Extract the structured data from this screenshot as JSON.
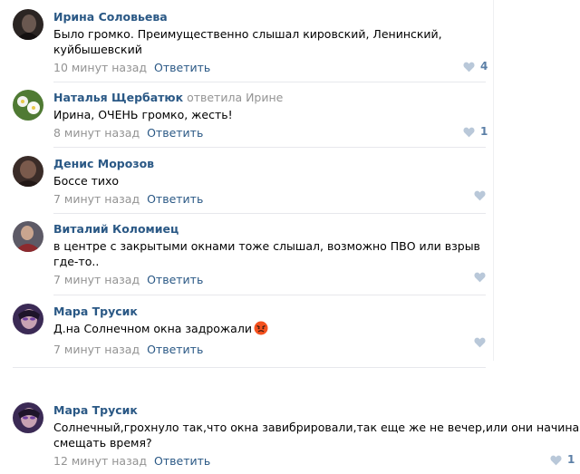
{
  "comments": [
    {
      "author": "Ирина Соловьева",
      "reply_note": "",
      "text_lines": [
        "Было громко. Преимущественно слышал кировский, Ленинский,",
        "куйбышевский"
      ],
      "time": "10 минут назад",
      "reply_label": "Ответить",
      "likes": "4"
    },
    {
      "author": "Наталья Щербатюк",
      "reply_note": "ответила Ирине",
      "text_lines": [
        "Ирина, ОЧЕНЬ громко, жесть!"
      ],
      "time": "8 минут назад",
      "reply_label": "Ответить",
      "likes": "1"
    },
    {
      "author": "Денис Морозов",
      "reply_note": "",
      "text_lines": [
        "Боссе тихо"
      ],
      "time": "7 минут назад",
      "reply_label": "Ответить",
      "likes": ""
    },
    {
      "author": "Виталий Коломиец",
      "reply_note": "",
      "text_lines": [
        "в центре с закрытыми окнами тоже слышал, возможно ПВО или взрыв",
        "где-то.."
      ],
      "time": "7 минут назад",
      "reply_label": "Ответить",
      "likes": ""
    },
    {
      "author": "Мара Трусик",
      "reply_note": "",
      "text_lines": [
        "Д.на Солнечном окна задрожали"
      ],
      "time": "7 минут назад",
      "reply_label": "Ответить",
      "likes": "",
      "emoji": "angry-face-emoji"
    },
    {
      "author": "Мара Трусик",
      "reply_note": "",
      "text_lines": [
        "Солнечный,грохнуло так,что окна завибрировали,так еще же не вечер,или они начинают",
        "смещать время?"
      ],
      "time": "12 минут назад",
      "reply_label": "Ответить",
      "likes": "1"
    }
  ],
  "colors": {
    "link": "#2a5885",
    "muted": "#939393",
    "like": "#5b7fa6",
    "like_empty": "#b9c8d9",
    "separator": "#e7e8ec"
  },
  "icons": {
    "like": "heart-icon"
  }
}
